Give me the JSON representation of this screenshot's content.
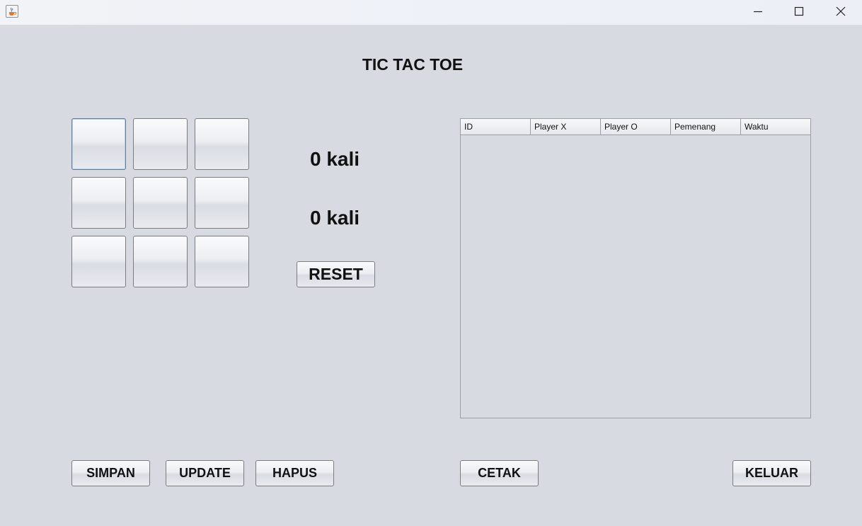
{
  "titlebar": {
    "icons": {
      "app": "java-cup-icon",
      "minimize": "minimize-icon",
      "maximize": "maximize-icon",
      "close": "close-icon"
    }
  },
  "game": {
    "title": "TIC TAC TOE",
    "board": [
      "",
      "",
      "",
      "",
      "",
      "",
      "",
      "",
      ""
    ],
    "score_x": "0 kali",
    "score_o": "0 kali",
    "reset_label": "RESET"
  },
  "table": {
    "columns": [
      "ID",
      "Player X",
      "Player O",
      "Pemenang",
      "Waktu"
    ],
    "rows": []
  },
  "actions": {
    "simpan": "SIMPAN",
    "update": "UPDATE",
    "hapus": "HAPUS",
    "cetak": "CETAK",
    "keluar": "KELUAR"
  },
  "colors": {
    "background": "#d8dae1",
    "focus_border": "#5a7fa8"
  }
}
